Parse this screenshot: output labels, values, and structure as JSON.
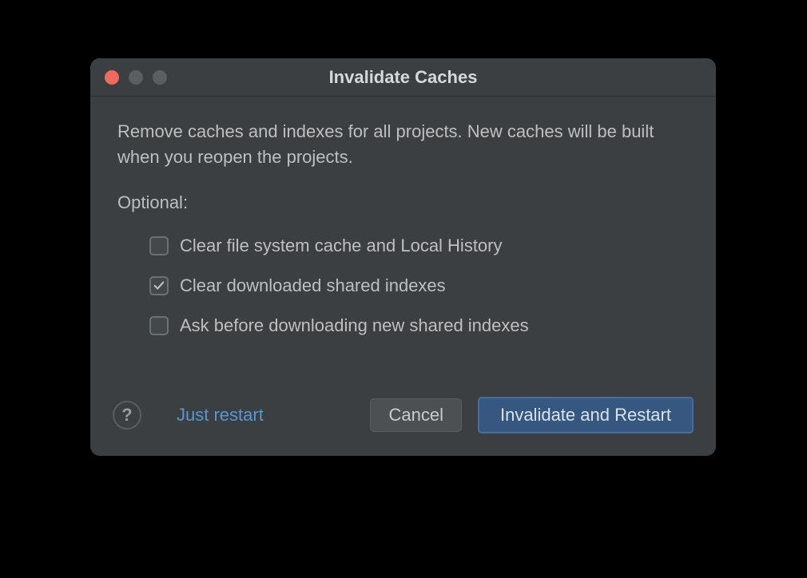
{
  "title": "Invalidate Caches",
  "description": "Remove caches and indexes for all projects. New caches will be built when you reopen the projects.",
  "optional_label": "Optional:",
  "checkboxes": [
    {
      "label": "Clear file system cache and Local History",
      "checked": false
    },
    {
      "label": "Clear downloaded shared indexes",
      "checked": true
    },
    {
      "label": "Ask before downloading new shared indexes",
      "checked": false
    }
  ],
  "help_glyph": "?",
  "buttons": {
    "just_restart": "Just restart",
    "cancel": "Cancel",
    "invalidate": "Invalidate and Restart"
  }
}
